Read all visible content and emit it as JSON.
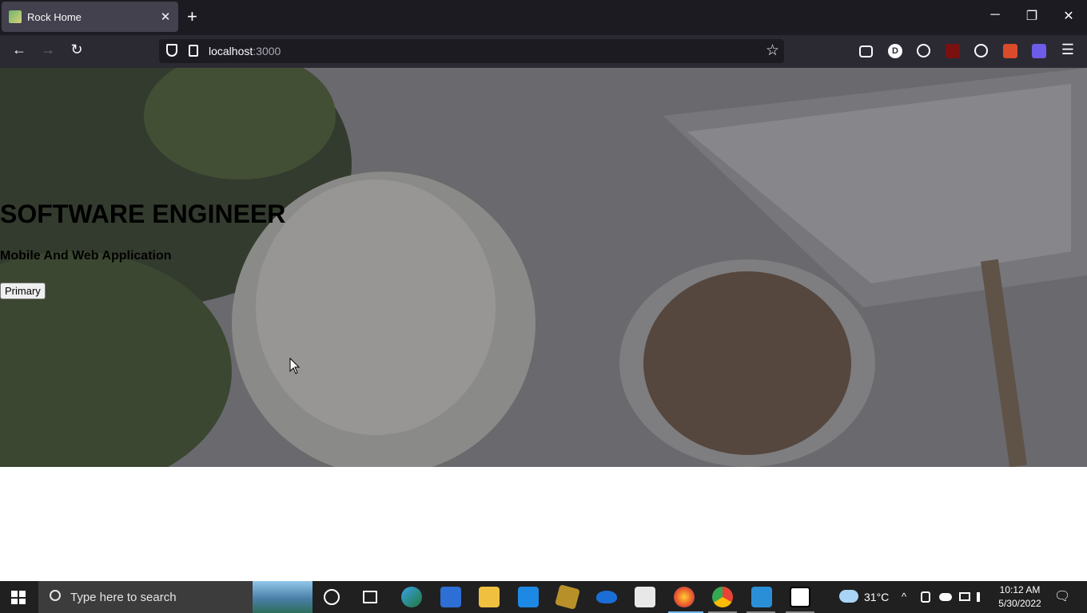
{
  "browser": {
    "tab": {
      "title": "Rock Home",
      "close": "✕"
    },
    "new_tab": "+",
    "window_controls": {
      "minimize": "─",
      "restore": "❐",
      "close": "✕"
    },
    "nav": {
      "back": "←",
      "forward": "→",
      "reload": "↻"
    },
    "url": {
      "host": "localhost",
      "port": ":3000"
    },
    "star": "☆",
    "menu": "☰",
    "profile_letter": "D"
  },
  "page": {
    "title": "SOFTWARE ENGINEER",
    "subtitle": "Mobile And Web Application",
    "button_label": "Primary"
  },
  "taskbar": {
    "search_placeholder": "Type here to search",
    "weather_temp": "31°C",
    "time": "10:12 AM",
    "date": "5/30/2022",
    "chevron": "^",
    "notification_icon": "🗨"
  }
}
